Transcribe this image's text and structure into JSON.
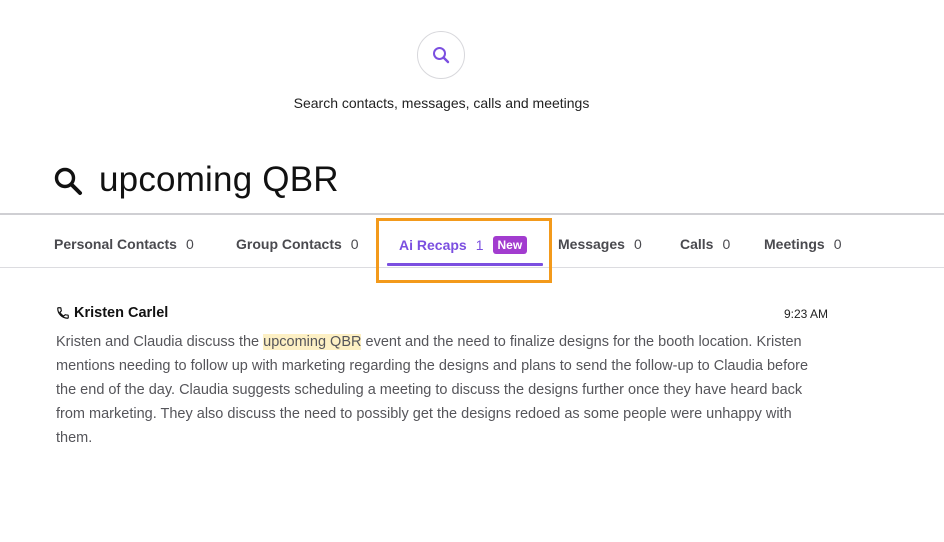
{
  "header": {
    "hint": "Search contacts, messages, calls and meetings",
    "icon": "search-icon"
  },
  "query": {
    "value": "upcoming QBR",
    "icon": "search-icon"
  },
  "tabs": [
    {
      "label": "Personal Contacts",
      "count": "0"
    },
    {
      "label": "Group Contacts",
      "count": "0"
    },
    {
      "label": "Ai Recaps",
      "count": "1",
      "badge": "New",
      "active": true
    },
    {
      "label": "Messages",
      "count": "0"
    },
    {
      "label": "Calls",
      "count": "0"
    },
    {
      "label": "Meetings",
      "count": "0"
    }
  ],
  "colors": {
    "accent": "#7b4fe0",
    "badge": "#a23ccf",
    "highlight_box": "#f39a1b",
    "match_highlight": "#fdf0c4"
  },
  "results": [
    {
      "icon": "phone-icon",
      "name": "Kristen Carlel",
      "time": "9:23 AM",
      "summary_before": "Kristen and Claudia discuss the ",
      "summary_match": "upcoming QBR",
      "summary_after": " event and the need to finalize designs for the booth location. Kristen mentions needing to follow up with marketing regarding the designs and plans to send the follow-up to Claudia before the end of the day. Claudia suggests scheduling a meeting to discuss the designs further once they have heard back from marketing. They also discuss the need to possibly get the designs redoed as some people were unhappy with them."
    }
  ]
}
